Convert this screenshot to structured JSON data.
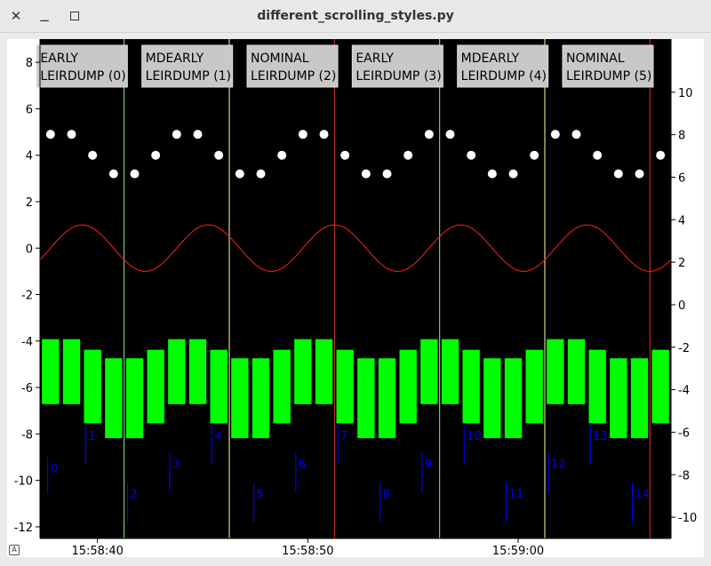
{
  "window": {
    "title": "different_scrolling_styles.py"
  },
  "chart_data": {
    "type": "line",
    "x_ticks": [
      "15:58:40",
      "15:58:50",
      "15:59:00"
    ],
    "left_axis": {
      "ylim": [
        -12.5,
        9
      ],
      "ticks": [
        -12,
        -10,
        -8,
        -6,
        -4,
        -2,
        0,
        2,
        4,
        6,
        8
      ]
    },
    "right_axis": {
      "ylim": [
        -11,
        12.5
      ],
      "ticks": [
        -10,
        -8,
        -6,
        -4,
        -2,
        0,
        2,
        4,
        6,
        8,
        10
      ]
    },
    "x_range": [
      0,
      30
    ],
    "annotations": [
      {
        "text_line1": "EARLY",
        "text_line2": "LEIRDUMP (0)",
        "x": 1.5
      },
      {
        "text_line1": "MDEARLY",
        "text_line2": "LEIRDUMP (1)",
        "x": 6.5
      },
      {
        "text_line1": "NOMINAL",
        "text_line2": "LEIRDUMP (2)",
        "x": 11.5
      },
      {
        "text_line1": "EARLY",
        "text_line2": "LEIRDUMP (3)",
        "x": 16.5
      },
      {
        "text_line1": "MDEARLY",
        "text_line2": "LEIRDUMP (4)",
        "x": 21.5
      },
      {
        "text_line1": "NOMINAL",
        "text_line2": "LEIRDUMP (5)",
        "x": 26.5
      }
    ],
    "vlines": [
      {
        "x": 3.5,
        "color": "#90ee90"
      },
      {
        "x": 8.5,
        "color": "#ffffa0"
      },
      {
        "x": 13.5,
        "color": "#e03030"
      },
      {
        "x": 18.5,
        "color": "#90ee90"
      },
      {
        "x": 23.5,
        "color": "#ffffa0"
      },
      {
        "x": 28.5,
        "color": "#e03030"
      }
    ],
    "dots": {
      "x": [
        0,
        1,
        2,
        3,
        4,
        5,
        6,
        7,
        8,
        9,
        10,
        11,
        12,
        13,
        14,
        15,
        16,
        17,
        18,
        19,
        20,
        21,
        22,
        23,
        24,
        25,
        26,
        27,
        28,
        29
      ],
      "y": [
        4.9,
        4.9,
        4.0,
        3.2,
        3.2,
        4.0,
        4.9,
        4.9,
        4.0,
        3.2,
        3.2,
        4.0,
        4.9,
        4.9,
        4.0,
        3.2,
        3.2,
        4.0,
        4.9,
        4.9,
        4.0,
        3.2,
        3.2,
        4.0,
        4.9,
        4.9,
        4.0,
        3.2,
        3.2,
        4.0
      ],
      "color": "#ffffff"
    },
    "sine": {
      "amplitude": 1,
      "period": 6,
      "phase_x": 1.5,
      "x_end": 30,
      "color": "#ff2020"
    },
    "bars": {
      "color": "#00ff00",
      "x": [
        0,
        1,
        2,
        3,
        4,
        5,
        6,
        7,
        8,
        9,
        10,
        11,
        12,
        13,
        14,
        15,
        16,
        17,
        18,
        19,
        20,
        21,
        22,
        23,
        24,
        25,
        26,
        27,
        28,
        29
      ],
      "top": [
        -1.6,
        -1.6,
        -2.1,
        -2.5,
        -2.5,
        -2.1,
        -1.6,
        -1.6,
        -2.1,
        -2.5,
        -2.5,
        -2.1,
        -1.6,
        -1.6,
        -2.1,
        -2.5,
        -2.5,
        -2.1,
        -1.6,
        -1.6,
        -2.1,
        -2.5,
        -2.5,
        -2.1,
        -1.6,
        -1.6,
        -2.1,
        -2.5,
        -2.5,
        -2.1
      ],
      "bottom": [
        -4.7,
        -4.7,
        -5.6,
        -6.3,
        -6.3,
        -5.6,
        -4.7,
        -4.7,
        -5.6,
        -6.3,
        -6.3,
        -5.6,
        -4.7,
        -4.7,
        -5.6,
        -6.3,
        -6.3,
        -5.6,
        -4.7,
        -4.7,
        -5.6,
        -6.3,
        -6.3,
        -5.6,
        -4.7,
        -4.7,
        -5.6,
        -6.3,
        -6.3,
        -5.6
      ]
    },
    "ticks": {
      "color": "#0000ff",
      "items": [
        {
          "label": "0",
          "x": 0.2,
          "top": -9.0,
          "bottom": -10.6
        },
        {
          "label": "1",
          "x": 2.0,
          "top": -7.6,
          "bottom": -9.3
        },
        {
          "label": "2",
          "x": 4.0,
          "top": -10.1,
          "bottom": -11.8
        },
        {
          "label": "3",
          "x": 6.0,
          "top": -8.8,
          "bottom": -10.5
        },
        {
          "label": "4",
          "x": 8.0,
          "top": -7.6,
          "bottom": -9.3
        },
        {
          "label": "5",
          "x": 10.0,
          "top": -10.1,
          "bottom": -11.8
        },
        {
          "label": "6",
          "x": 12.0,
          "top": -8.8,
          "bottom": -10.5
        },
        {
          "label": "7",
          "x": 14.0,
          "top": -7.6,
          "bottom": -9.3
        },
        {
          "label": "8",
          "x": 16.0,
          "top": -10.1,
          "bottom": -11.8
        },
        {
          "label": "9",
          "x": 18.0,
          "top": -8.8,
          "bottom": -10.5
        },
        {
          "label": "10",
          "x": 20.0,
          "top": -7.6,
          "bottom": -9.3
        },
        {
          "label": "11",
          "x": 22.0,
          "top": -10.1,
          "bottom": -11.8
        },
        {
          "label": "12",
          "x": 24.0,
          "top": -8.8,
          "bottom": -10.5
        },
        {
          "label": "13",
          "x": 26.0,
          "top": -7.6,
          "bottom": -9.3
        },
        {
          "label": "14",
          "x": 28.0,
          "top": -10.1,
          "bottom": -11.8
        }
      ]
    }
  }
}
